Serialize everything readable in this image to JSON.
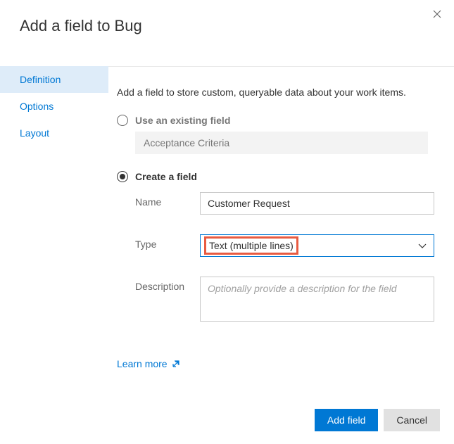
{
  "dialog": {
    "title": "Add a field to Bug",
    "intro": "Add a field to store custom, queryable data about your work items."
  },
  "sidebar": {
    "items": [
      {
        "label": "Definition",
        "active": true
      },
      {
        "label": "Options",
        "active": false
      },
      {
        "label": "Layout",
        "active": false
      }
    ]
  },
  "options": {
    "existing": {
      "label": "Use an existing field",
      "value": "Acceptance Criteria"
    },
    "create": {
      "label": "Create a field"
    }
  },
  "form": {
    "name": {
      "label": "Name",
      "value": "Customer Request"
    },
    "type": {
      "label": "Type",
      "value": "Text (multiple lines)"
    },
    "description": {
      "label": "Description",
      "placeholder": "Optionally provide a description for the field"
    }
  },
  "learnMore": "Learn more",
  "footer": {
    "primary": "Add field",
    "cancel": "Cancel"
  }
}
